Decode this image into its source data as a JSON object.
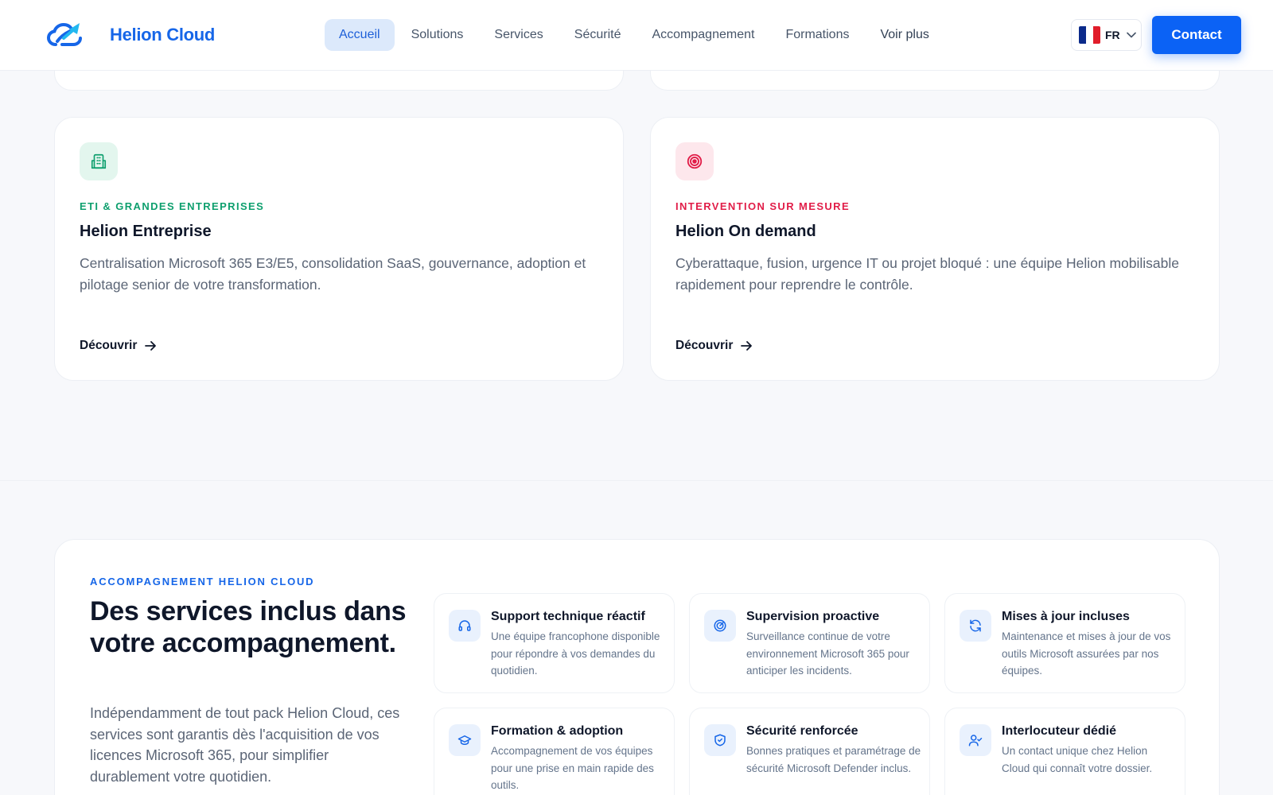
{
  "header": {
    "brand": "Helion Cloud",
    "nav": [
      {
        "label": "Accueil",
        "active": true
      },
      {
        "label": "Solutions",
        "active": false
      },
      {
        "label": "Services",
        "active": false
      },
      {
        "label": "Sécurité",
        "active": false
      },
      {
        "label": "Accompagnement",
        "active": false
      },
      {
        "label": "Formations",
        "active": false
      },
      {
        "label": "Voir plus",
        "active": false
      }
    ],
    "language": {
      "code": "FR",
      "icon": "flag-france-icon"
    },
    "contact_label": "Contact"
  },
  "offers": [
    {
      "eyebrow": "ETI & GRANDES ENTREPRISES",
      "title": "Helion Entreprise",
      "description": "Centralisation Microsoft 365 E3/E5, consolidation SaaS, gouvernance, adoption et pilotage senior de votre transformation.",
      "link_label": "Découvrir",
      "icon": "building-icon",
      "accent_color": "#0e9f6e",
      "icon_bg": "#e3f6ee"
    },
    {
      "eyebrow": "INTERVENTION SUR MESURE",
      "title": "Helion On demand",
      "description": "Cyberattaque, fusion, urgence IT ou projet bloqué : une équipe Helion mobilisable rapidement pour reprendre le contrôle.",
      "link_label": "Découvrir",
      "icon": "target-icon",
      "accent_color": "#e11d48",
      "icon_bg": "#fde7ec"
    }
  ],
  "services": {
    "eyebrow": "ACCOMPAGNEMENT HELION CLOUD",
    "title": "Des services inclus dans votre accompagnement.",
    "description": "Indépendamment de tout pack Helion Cloud, ces services sont garantis dès l'acquisition de vos licences Microsoft 365, pour simplifier durablement votre quotidien.",
    "items": [
      {
        "title": "Support technique réactif",
        "description": "Une équipe francophone disponible pour répondre à vos demandes du quotidien.",
        "icon": "headset-icon"
      },
      {
        "title": "Supervision proactive",
        "description": "Surveillance continue de votre environnement Microsoft 365 pour anticiper les incidents.",
        "icon": "radar-icon"
      },
      {
        "title": "Mises à jour incluses",
        "description": "Maintenance et mises à jour de vos outils Microsoft assurées par nos équipes.",
        "icon": "refresh-icon"
      },
      {
        "title": "Formation & adoption",
        "description": "Accompagnement de vos équipes pour une prise en main rapide des outils.",
        "icon": "graduation-cap-icon"
      },
      {
        "title": "Sécurité renforcée",
        "description": "Bonnes pratiques et paramétrage de sécurité Microsoft Defender inclus.",
        "icon": "shield-check-icon"
      },
      {
        "title": "Interlocuteur dédié",
        "description": "Un contact unique chez Helion Cloud qui connaît votre dossier.",
        "icon": "user-check-icon"
      }
    ]
  },
  "colors": {
    "brand": "#1666e8",
    "primary_button": "#0b62f5",
    "nav_active_bg": "#dce9fb",
    "service_icon_bg": "#e9f1fd"
  }
}
